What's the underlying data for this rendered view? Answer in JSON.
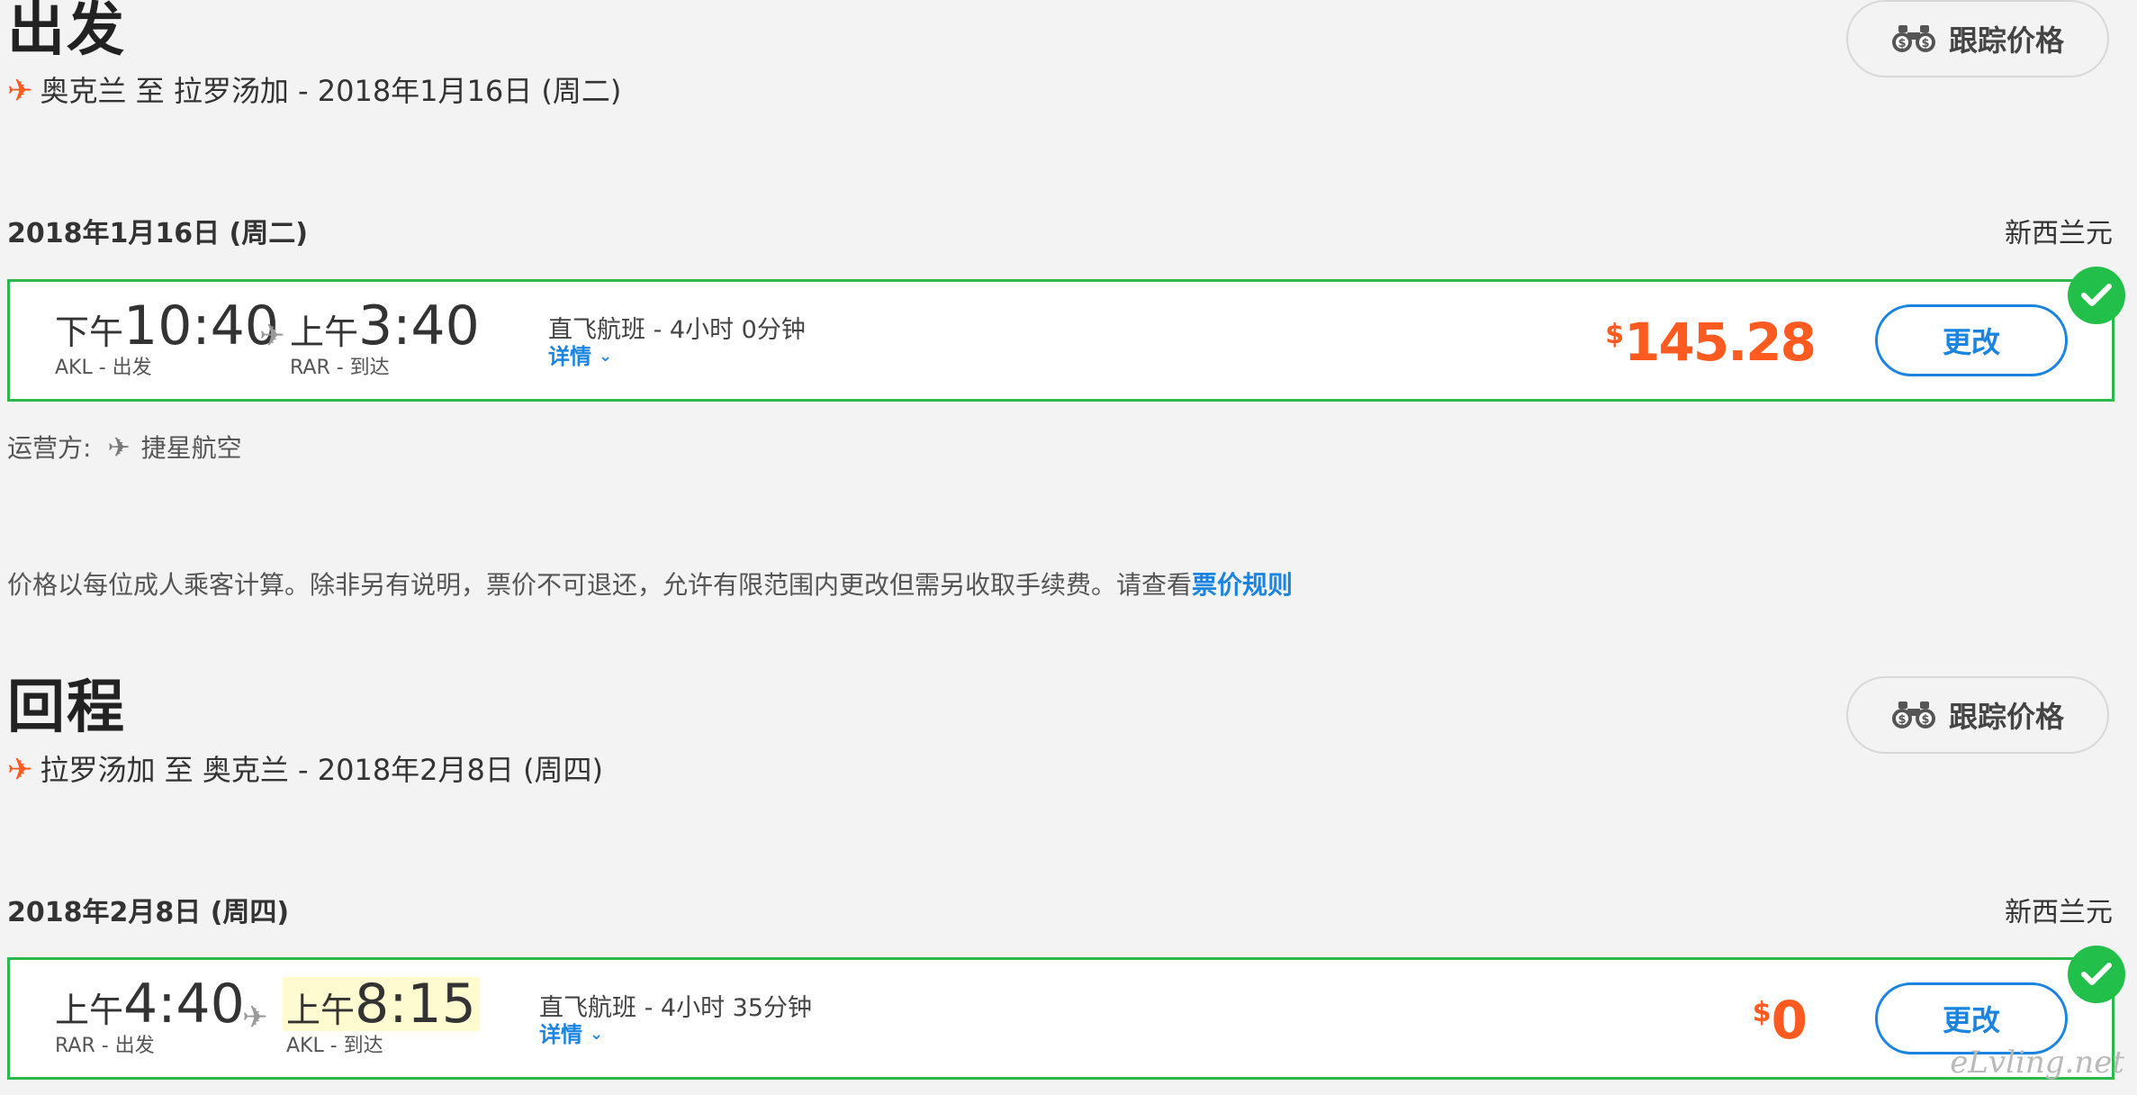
{
  "outbound": {
    "heading": "出发",
    "route": "奥克兰 至 拉罗汤加 - 2018年1月16日 (周二)",
    "track_label": "跟踪价格",
    "date": "2018年1月16日 (周二)",
    "currency": "新西兰元",
    "dep_period": "下午",
    "dep_time": "10:40",
    "dep_airport": "AKL - 出发",
    "arr_period": "上午",
    "arr_time": "3:40",
    "arr_airport": "RAR - 到达",
    "flight_info": "直飞航班 - 4小时 0分钟",
    "details": "详情",
    "price_symbol": "$",
    "price": "145.28",
    "change_label": "更改",
    "operator_label": "运营方:",
    "operator": "捷星航空"
  },
  "notice": {
    "text": "价格以每位成人乘客计算。除非另有说明，票价不可退还，允许有限范围内更改但需另收取手续费。请查看",
    "link": "票价规则"
  },
  "return": {
    "heading": "回程",
    "route": "拉罗汤加 至 奥克兰 - 2018年2月8日 (周四)",
    "track_label": "跟踪价格",
    "date": "2018年2月8日 (周四)",
    "currency": "新西兰元",
    "dep_period": "上午",
    "dep_time": "4:40",
    "dep_airport": "RAR - 出发",
    "arr_period": "上午",
    "arr_time": "8:15",
    "arr_airport": "AKL - 到达",
    "flight_info": "直飞航班 - 4小时 35分钟",
    "details": "详情",
    "price_symbol": "$",
    "price": "0",
    "change_label": "更改"
  },
  "watermark": "eLvling.net",
  "colors": {
    "accent_orange": "#ff5a1f",
    "link_blue": "#1a84e0",
    "selected_green": "#2db84d"
  }
}
